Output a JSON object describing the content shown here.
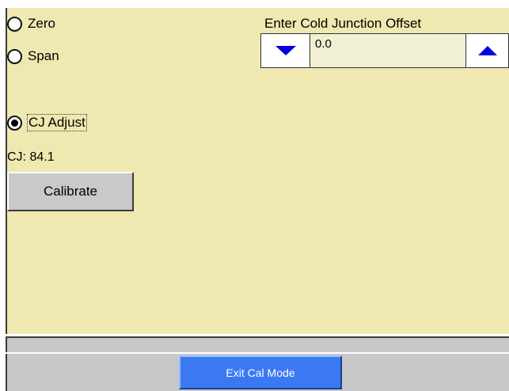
{
  "mode_options": {
    "zero": {
      "label": "Zero",
      "selected": false
    },
    "span": {
      "label": "Span",
      "selected": false
    },
    "cj_adjust": {
      "label": "CJ Adjust",
      "selected": true
    }
  },
  "cj_reading": "CJ: 84.1",
  "calibrate_label": "Calibrate",
  "cold_junction_offset": {
    "title": "Enter Cold Junction Offset",
    "value": "0.0",
    "decrement_icon": "triangle-down",
    "increment_icon": "triangle-up",
    "arrow_color": "#0000e0"
  },
  "exit_label": "Exit Cal Mode",
  "colors": {
    "panel_background": "#efe8b0",
    "toolbar_background": "#c7c7c7",
    "exit_button": "#3b79f3"
  }
}
